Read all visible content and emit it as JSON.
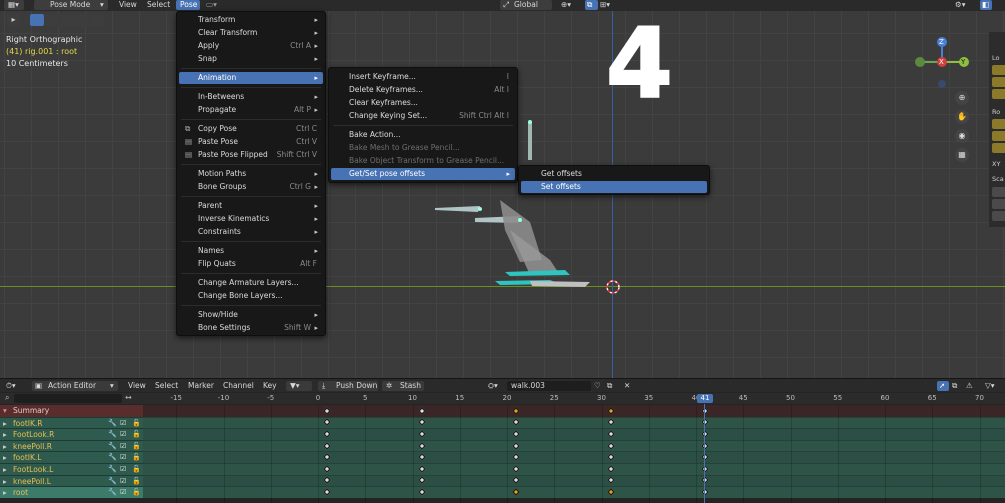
{
  "viewport": {
    "header": {
      "mode": "Pose Mode",
      "menus": [
        "View",
        "Select",
        "Pose"
      ],
      "transform_orientation": "Global"
    },
    "overlay": {
      "view_name": "Right Orthographic",
      "object_info": "(41) rig.001 : root",
      "scale": "10 Centimeters"
    },
    "annotation_number": "4",
    "gizmo": {
      "z": "Z",
      "x": "X",
      "y": "Y"
    },
    "side_panel": {
      "label_top": "Lo",
      "label_rot": "Ro",
      "label_scale": "Sca",
      "xy": "XY"
    }
  },
  "pose_menu": {
    "items": [
      {
        "label": "Transform",
        "shortcut": "",
        "submenu": true
      },
      {
        "label": "Clear Transform",
        "shortcut": "",
        "submenu": true
      },
      {
        "label": "Apply",
        "shortcut": "Ctrl A",
        "submenu": true
      },
      {
        "label": "Snap",
        "shortcut": "",
        "submenu": true
      },
      {
        "label": "Animation",
        "shortcut": "",
        "submenu": true,
        "highlighted": true
      },
      {
        "label": "In-Betweens",
        "shortcut": "",
        "submenu": true
      },
      {
        "label": "Propagate",
        "shortcut": "Alt P",
        "submenu": true
      },
      {
        "label": "Copy Pose",
        "shortcut": "Ctrl C",
        "submenu": false
      },
      {
        "label": "Paste Pose",
        "shortcut": "Ctrl V",
        "submenu": false
      },
      {
        "label": "Paste Pose Flipped",
        "shortcut": "Shift Ctrl V",
        "submenu": false
      },
      {
        "label": "Motion Paths",
        "shortcut": "",
        "submenu": true
      },
      {
        "label": "Bone Groups",
        "shortcut": "Ctrl G",
        "submenu": true
      },
      {
        "label": "Parent",
        "shortcut": "",
        "submenu": true
      },
      {
        "label": "Inverse Kinematics",
        "shortcut": "",
        "submenu": true
      },
      {
        "label": "Constraints",
        "shortcut": "",
        "submenu": true
      },
      {
        "label": "Names",
        "shortcut": "",
        "submenu": true
      },
      {
        "label": "Flip Quats",
        "shortcut": "Alt F",
        "submenu": false
      },
      {
        "label": "Change Armature Layers...",
        "shortcut": "",
        "submenu": false
      },
      {
        "label": "Change Bone Layers...",
        "shortcut": "",
        "submenu": false
      },
      {
        "label": "Show/Hide",
        "shortcut": "",
        "submenu": true
      },
      {
        "label": "Bone Settings",
        "shortcut": "Shift W",
        "submenu": true
      }
    ]
  },
  "animation_menu": {
    "items": [
      {
        "label": "Insert Keyframe...",
        "shortcut": "I",
        "submenu": false
      },
      {
        "label": "Delete Keyframes...",
        "shortcut": "Alt I",
        "submenu": false
      },
      {
        "label": "Clear Keyframes...",
        "shortcut": "",
        "submenu": false
      },
      {
        "label": "Change Keying Set...",
        "shortcut": "Shift Ctrl Alt I",
        "submenu": false
      },
      {
        "label": "Bake Action...",
        "shortcut": "",
        "submenu": false
      },
      {
        "label": "Bake Mesh to Grease Pencil...",
        "shortcut": "",
        "submenu": false,
        "disabled": true
      },
      {
        "label": "Bake Object Transform to Grease Pencil...",
        "shortcut": "",
        "submenu": false,
        "disabled": true
      },
      {
        "label": "Get/Set pose offsets",
        "shortcut": "",
        "submenu": true,
        "highlighted": true
      }
    ]
  },
  "offsets_menu": {
    "items": [
      {
        "label": "Get offsets",
        "highlighted": false
      },
      {
        "label": "Set offsets",
        "highlighted": true
      }
    ]
  },
  "action_editor": {
    "header": {
      "mode": "Action Editor",
      "menus": [
        "View",
        "Select",
        "Marker",
        "Channel",
        "Key"
      ],
      "push_down": "Push Down",
      "stash": "Stash",
      "action_name": "walk.003"
    },
    "current_frame": "41",
    "ruler_ticks": [
      "-15",
      "-10",
      "-5",
      "0",
      "5",
      "10",
      "15",
      "20",
      "25",
      "30",
      "35",
      "40",
      "45",
      "50",
      "55",
      "60",
      "65",
      "70"
    ],
    "channels": [
      {
        "name": "Summary",
        "summary": true
      },
      {
        "name": "footIK.R"
      },
      {
        "name": "FootLook.R"
      },
      {
        "name": "kneePoll.R"
      },
      {
        "name": "footIK.L"
      },
      {
        "name": "FootLook.L"
      },
      {
        "name": "kneePoll.L"
      },
      {
        "name": "root"
      }
    ],
    "keyframe_frames": [
      1,
      11,
      21,
      31,
      41
    ],
    "colors": {
      "selected_key": "#e8a020",
      "key": "#dcdcdc",
      "playhead": "#4772b3",
      "channel_green": "#2f5a4e",
      "summary_red": "#5a2d2d"
    }
  }
}
